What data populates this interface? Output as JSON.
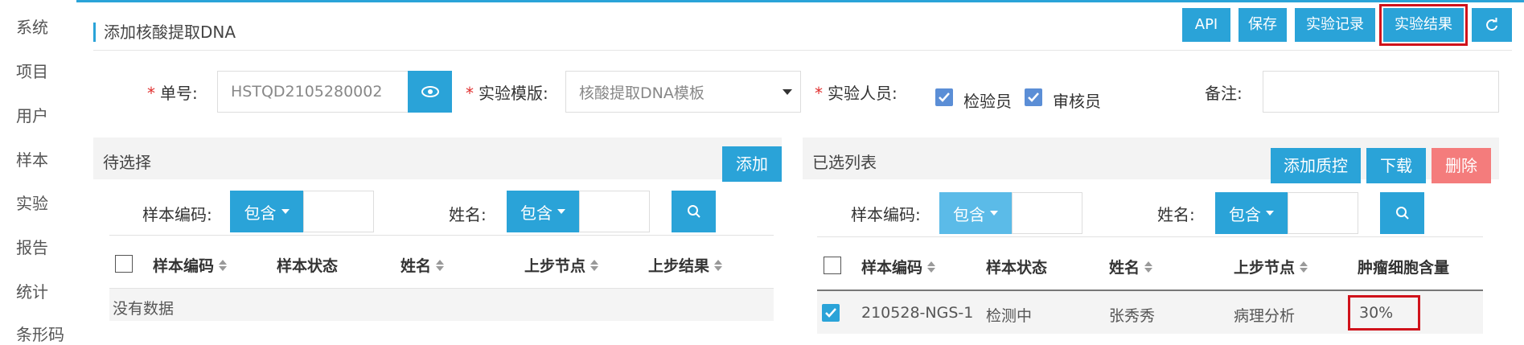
{
  "sidebar": {
    "items": [
      "系统",
      "项目",
      "用户",
      "样本",
      "实验",
      "报告",
      "统计",
      "条形码"
    ]
  },
  "header": {
    "title": "添加核酸提取DNA",
    "buttons": {
      "api": "API",
      "save": "保存",
      "records": "实验记录",
      "results": "实验结果",
      "refresh_icon": "refresh-icon"
    }
  },
  "form": {
    "order_label": "单号:",
    "order_value": "HSTQD2105280002",
    "template_label": "实验模版:",
    "template_value": "核酸提取DNA模板",
    "staff_label": "实验人员:",
    "staff": [
      {
        "label": "检验员",
        "checked": true
      },
      {
        "label": "审核员",
        "checked": true
      }
    ],
    "remark_label": "备注:",
    "remark_value": ""
  },
  "left_panel": {
    "title": "待选择",
    "add_button": "添加",
    "filter": {
      "code_label": "样本编码:",
      "code_op": "包含",
      "name_label": "姓名:",
      "name_op": "包含"
    },
    "columns": [
      "样本编码",
      "样本状态",
      "姓名",
      "上步节点",
      "上步结果"
    ],
    "empty_text": "没有数据"
  },
  "right_panel": {
    "title": "已选列表",
    "buttons": {
      "add_qc": "添加质控",
      "download": "下载",
      "delete": "删除"
    },
    "filter": {
      "code_label": "样本编码:",
      "code_op": "包含",
      "name_label": "姓名:",
      "name_op": "包含"
    },
    "columns": [
      "样本编码",
      "样本状态",
      "姓名",
      "上步节点",
      "肿瘤细胞含量"
    ],
    "rows": [
      {
        "code": "210528-NGS-1",
        "status": "检测中",
        "name": "张秀秀",
        "prev_node": "病理分析",
        "tumor": "30%",
        "checked": true
      }
    ]
  },
  "colors": {
    "accent": "#2aa3d8",
    "danger": "#f47c7c",
    "highlight": "#d0121b"
  }
}
